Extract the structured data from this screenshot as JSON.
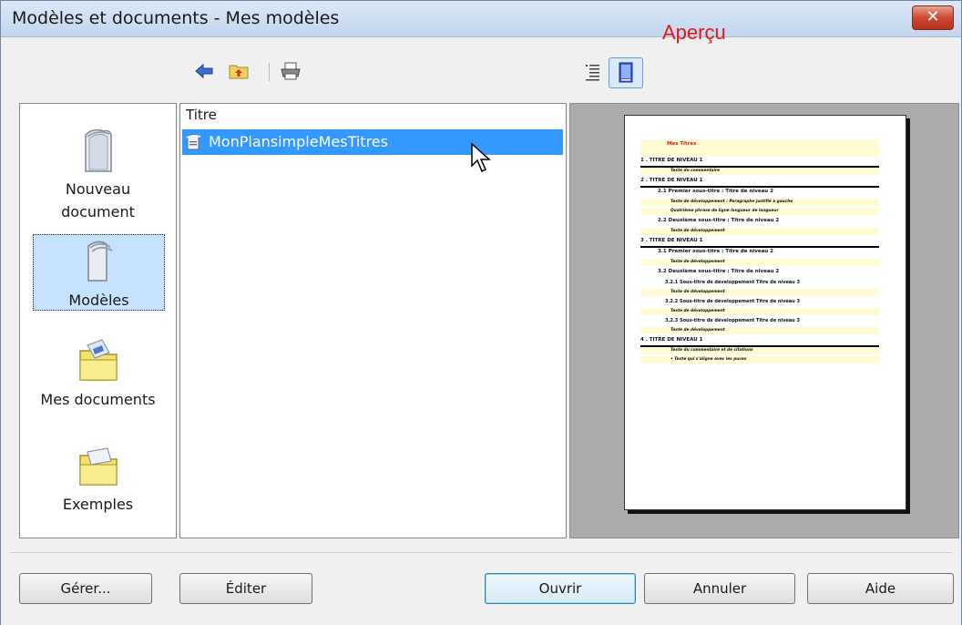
{
  "window": {
    "title": "Modèles et documents - Mes modèles",
    "close_label": "✕"
  },
  "toolbar": {
    "back_icon": "back-arrow-icon",
    "up_icon": "folder-up-icon",
    "print_icon": "print-icon",
    "doc_props_icon": "document-properties-icon",
    "preview_icon": "preview-icon",
    "preview_label": "Aperçu"
  },
  "categories": [
    {
      "label_line1": "Nouveau",
      "label_line2": "document",
      "accel": "N",
      "icon": "new-document-icon",
      "selected": false
    },
    {
      "label_line1": "Modèles",
      "label_line2": "",
      "accel": "M",
      "icon": "templates-icon",
      "selected": true
    },
    {
      "label_line1": "Mes documents",
      "label_line2": "",
      "accel": "d",
      "icon": "my-documents-folder-icon",
      "selected": false
    },
    {
      "label_line1": "Exemples",
      "label_line2": "",
      "accel": "E",
      "icon": "examples-folder-icon",
      "selected": false
    }
  ],
  "list": {
    "column_header": "Titre",
    "rows": [
      {
        "name": "MonPlansimpleMesTitres",
        "selected": true,
        "icon": "template-file-icon"
      }
    ]
  },
  "preview_doc": {
    "title": "Mes Titres",
    "lines": [
      {
        "text": "1 . TITRE DE NIVEAU 1",
        "kind": "h1"
      },
      {
        "text": "Texte du commentaire",
        "kind": "body"
      },
      {
        "text": "2 . TITRE DE NIVEAU 1",
        "kind": "h1"
      },
      {
        "text": "2.1  Premier sous-titre : Titre de niveau 2",
        "kind": "h2"
      },
      {
        "text": "Texte de développement : Paragraphe justifié à gauche",
        "kind": "body"
      },
      {
        "text": "Quatrième phrase de ligne longueur de longueur",
        "kind": "body"
      },
      {
        "text": "2.2  Deuxième sous-titre : Titre de niveau 2",
        "kind": "h2"
      },
      {
        "text": "Texte de développement",
        "kind": "body"
      },
      {
        "text": "3 . TITRE DE NIVEAU 1",
        "kind": "h1"
      },
      {
        "text": "3.1  Premier sous-titre : Titre de niveau 2",
        "kind": "h2"
      },
      {
        "text": "Texte de développement",
        "kind": "body"
      },
      {
        "text": "3.2  Deuxième sous-titre : Titre de niveau 2",
        "kind": "h2"
      },
      {
        "text": "3.2.1  Sous-titre de développement Titre de niveau 3",
        "kind": "h3"
      },
      {
        "text": "Texte de développement",
        "kind": "body"
      },
      {
        "text": "3.2.2  Sous-titre de développement Titre de niveau 3",
        "kind": "h3"
      },
      {
        "text": "Texte de développement",
        "kind": "body"
      },
      {
        "text": "3.2.3  Sous-titre de développement Titre de niveau 3",
        "kind": "h3"
      },
      {
        "text": "Texte de développement",
        "kind": "body"
      },
      {
        "text": "4 . TITRE DE NIVEAU 1",
        "kind": "h1"
      },
      {
        "text": "Texte du commentaire et de citations",
        "kind": "body"
      },
      {
        "text": "•  Texte qui s'aligne avec les puces",
        "kind": "body"
      }
    ]
  },
  "buttons": {
    "manage": {
      "label": "Gérer...",
      "accel": "G"
    },
    "edit": {
      "label": "Éditer",
      "accel": "t"
    },
    "open": {
      "label": "Ouvrir",
      "accel": "O"
    },
    "cancel": {
      "label": "Annuler"
    },
    "help": {
      "label": "Aide"
    }
  },
  "colors": {
    "accent": "#3399ff",
    "preview_label": "#e01818",
    "title_bar": "#c3d6ee",
    "close": "#cc4a33"
  }
}
